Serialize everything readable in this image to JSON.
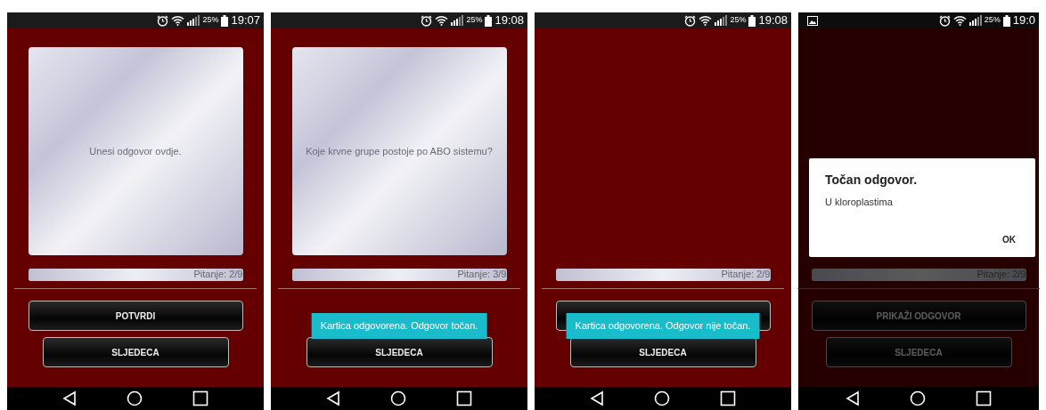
{
  "screens": [
    {
      "status_bar": {
        "notification_icon": false,
        "battery": "25%",
        "time": "19:07"
      },
      "card": {
        "text": "Unesi odgovor ovdje."
      },
      "progress": {
        "level": 1,
        "label": "Pitanje: 2/9"
      },
      "buttons": [
        {
          "kind": "primary",
          "label": "POTVRDI"
        },
        {
          "kind": "secondary",
          "label": "SLJEDECA"
        }
      ]
    },
    {
      "status_bar": {
        "notification_icon": false,
        "battery": "25%",
        "time": "19:08"
      },
      "card": {
        "text": "Koje krvne grupe postoje po ABO sistemu?"
      },
      "progress": {
        "level": 1,
        "label": "Pitanje: 3/9"
      },
      "buttons": [
        {
          "kind": "secondary",
          "label": "SLJEDECA"
        }
      ],
      "toast": "Kartica odgovorena. Odgovor točan."
    },
    {
      "status_bar": {
        "notification_icon": false,
        "battery": "25%",
        "time": "19:08"
      },
      "progress": {
        "level": 1,
        "label": "Pitanje: 2/9"
      },
      "buttons": [
        {
          "kind": "primary"
        },
        {
          "kind": "secondary",
          "label": "SLJEDECA"
        }
      ],
      "toast": "Kartica odgovorena. Odgovor nije točan."
    },
    {
      "status_bar": {
        "notification_icon": true,
        "battery": "25%",
        "time": "19:0"
      },
      "progress": {
        "level": 1,
        "label": "Pitanje: 2/9"
      },
      "buttons": [
        {
          "kind": "primary",
          "label": "PRIKAŽI ODGOVOR"
        },
        {
          "kind": "secondary",
          "label": "SLJEDECA"
        }
      ],
      "dialog": {
        "title": "Točan odgovor.",
        "message": "U kloroplastima",
        "button": "OK"
      }
    }
  ]
}
